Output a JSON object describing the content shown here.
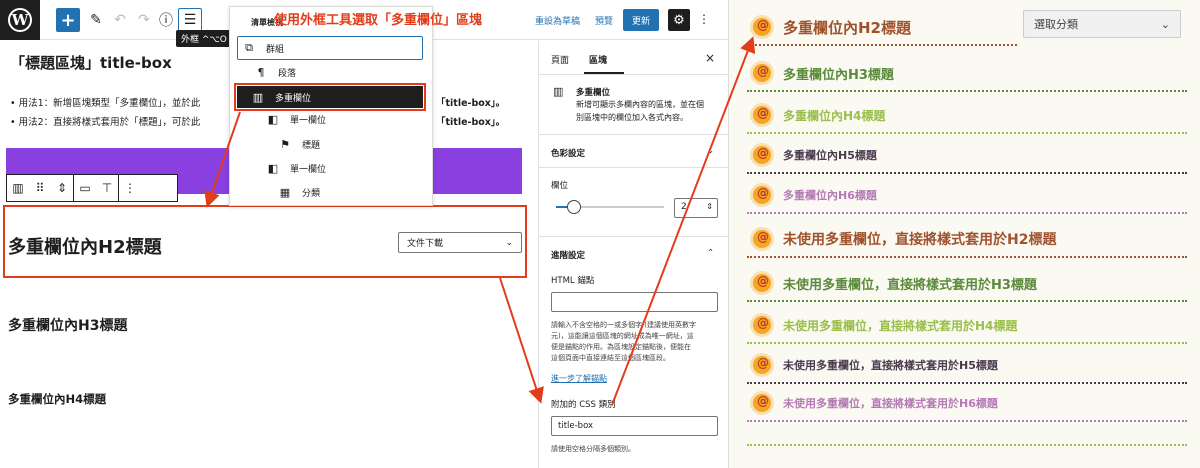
{
  "toolbar": {
    "tooltip": "外框 ^⌥O",
    "reset_draft": "重設為草稿",
    "preview": "預覽",
    "update": "更新"
  },
  "annotation": {
    "heading": "使用外框工具選取「多重欄位」區塊"
  },
  "canvas": {
    "page_title": "「標題區塊」title-box",
    "method1": "• 用法1：新增區塊類型「多重欄位」，並於此",
    "method1_end": "「title-box」。",
    "method2": "• 用法2：直接將樣式套用於「標題」，可於此",
    "method2_end": "「title-box」。",
    "h2": "多重欄位內H2標題",
    "select_value": "文件下載",
    "h3": "多重欄位內H3標題",
    "h4": "多重欄位內H4標題"
  },
  "list_view": {
    "title": "清單檢視",
    "items": [
      {
        "label": "群組",
        "icon": "group-icon"
      },
      {
        "label": "段落",
        "icon": "paragraph-icon"
      },
      {
        "label": "多重欄位",
        "icon": "columns-icon"
      },
      {
        "label": "單一欄位",
        "icon": "column-icon"
      },
      {
        "label": "標題",
        "icon": "bookmark-icon"
      },
      {
        "label": "單一欄位",
        "icon": "column-icon"
      },
      {
        "label": "分類",
        "icon": "calendar-icon"
      }
    ]
  },
  "sidebar": {
    "tab_page": "頁面",
    "tab_block": "區塊",
    "block_name": "多重欄位",
    "block_desc_1": "新增可顯示多欄內容的區塊，並在個",
    "block_desc_2": "別區塊中的欄位加入各式內容。",
    "color_settings": "色彩設定",
    "columns_label": "欄位",
    "columns_value": "2",
    "columns_fraction": 0.17,
    "advanced": "進階設定",
    "html_anchor": "HTML 錨點",
    "anchor_help_1": "請輸入不含空格的一或多個字 (建議使用英數字",
    "anchor_help_2": "元)，這能讓這個區塊的網址成為唯一網址，這",
    "anchor_help_3": "便是錨點的作用。為區塊設定錨點後，便能在",
    "anchor_help_4": "這個頁面中直接連結至這個區塊區段。",
    "learn_more": "進一步了解錨點",
    "css_label": "附加的 CSS 類別",
    "css_value": "title-box",
    "css_help": "請使用空格分隔多個類別。"
  },
  "preview": {
    "select_label": "選取分類",
    "rows": [
      {
        "text": "多重欄位內H2標題",
        "color": "#a0522d"
      },
      {
        "text": "多重欄位內H3標題",
        "color": "#5b8a3a"
      },
      {
        "text": "多重欄位內H4標題",
        "color": "#9bbf4a"
      },
      {
        "text": "多重欄位內H5標題",
        "color": "#4a3b4f"
      },
      {
        "text": "多重欄位內H6標題",
        "color": "#b57ab5"
      },
      {
        "text": "未使用多重欄位，直接將樣式套用於H2標題",
        "color": "#a0522d"
      },
      {
        "text": "未使用多重欄位，直接將樣式套用於H3標題",
        "color": "#5b8a3a"
      },
      {
        "text": "未使用多重欄位，直接將樣式套用於H4標題",
        "color": "#9bbf4a"
      },
      {
        "text": "未使用多重欄位，直接將樣式套用於H5標題",
        "color": "#4a3b4f"
      },
      {
        "text": "未使用多重欄位，直接將樣式套用於H6標題",
        "color": "#b57ab5"
      }
    ]
  },
  "colors": {
    "accent": "#2271b1",
    "annotation_red": "#e23d1a",
    "block_bg": "#8a3fe0"
  }
}
